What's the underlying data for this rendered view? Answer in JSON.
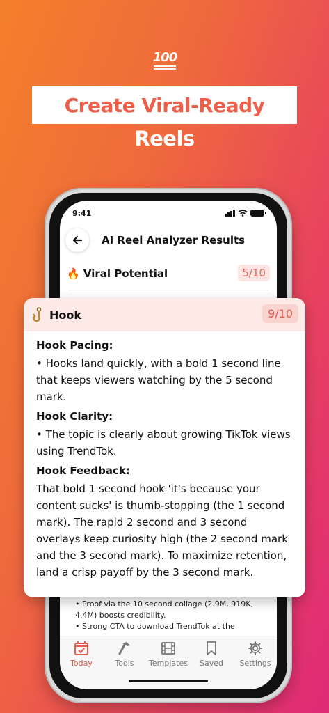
{
  "badge": {
    "text": "100"
  },
  "headline": {
    "line1": "Create Viral-Ready",
    "line2": "Reels"
  },
  "status": {
    "time": "9:41"
  },
  "app": {
    "title": "AI Reel Analyzer Results",
    "back_icon": "arrow-left-icon",
    "viral": {
      "emoji": "🔥",
      "label": "Viral Potential",
      "score": "5/10"
    }
  },
  "card": {
    "icon": "hook-icon",
    "title": "Hook",
    "score": "9/10",
    "sections": [
      {
        "heading": "Hook Pacing:",
        "text": "• Hooks land quickly, with a bold 1 second line that keeps viewers watching by the 5 second mark."
      },
      {
        "heading": "Hook Clarity:",
        "text": "• The topic is clearly about growing TikTok views using TrendTok."
      },
      {
        "heading": "Hook Feedback:",
        "text": "That bold 1 second hook 'it's because your content sucks' is thumb-stopping (the 1 second mark). The rapid 2 second and 3 second overlays keep curiosity high (the 2 second mark and the 3 second mark). To maximize retention, land a crisp payoff by the 3 second mark."
      }
    ]
  },
  "bottom": {
    "line1": "• Proof via the 10 second collage (2.9M, 919K, 4.4M) boosts credibility.",
    "line2": "• Strong CTA to download TrendTok at the"
  },
  "tabs": [
    {
      "label": "Today",
      "icon": "calendar-check-icon",
      "active": true
    },
    {
      "label": "Tools",
      "icon": "hammer-icon"
    },
    {
      "label": "Templates",
      "icon": "film-icon"
    },
    {
      "label": "Saved",
      "icon": "bookmark-icon"
    },
    {
      "label": "Settings",
      "icon": "gear-icon"
    }
  ],
  "colors": {
    "accent": "#e25b4a",
    "score_bg": "#f9d3cf"
  }
}
